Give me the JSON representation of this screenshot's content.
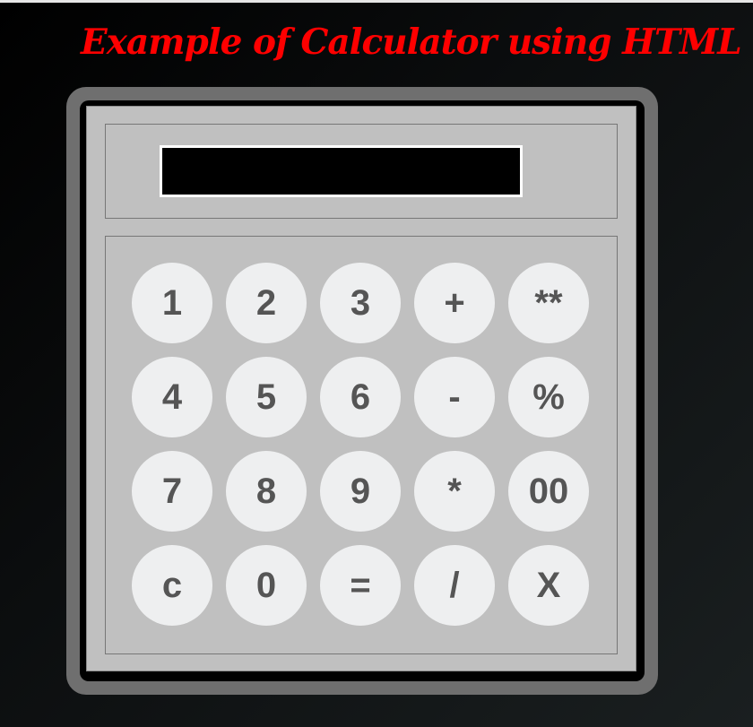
{
  "page": {
    "title": "Example of Calculator using HTML"
  },
  "display": {
    "value": ""
  },
  "keys": [
    {
      "label": "1",
      "name": "key-1"
    },
    {
      "label": "2",
      "name": "key-2"
    },
    {
      "label": "3",
      "name": "key-3"
    },
    {
      "label": "+",
      "name": "key-plus"
    },
    {
      "label": "**",
      "name": "key-power"
    },
    {
      "label": "4",
      "name": "key-4"
    },
    {
      "label": "5",
      "name": "key-5"
    },
    {
      "label": "6",
      "name": "key-6"
    },
    {
      "label": "-",
      "name": "key-minus"
    },
    {
      "label": "%",
      "name": "key-percent"
    },
    {
      "label": "7",
      "name": "key-7"
    },
    {
      "label": "8",
      "name": "key-8"
    },
    {
      "label": "9",
      "name": "key-9"
    },
    {
      "label": "*",
      "name": "key-multiply"
    },
    {
      "label": "00",
      "name": "key-double-zero"
    },
    {
      "label": "c",
      "name": "key-clear"
    },
    {
      "label": "0",
      "name": "key-0"
    },
    {
      "label": "=",
      "name": "key-equals"
    },
    {
      "label": "/",
      "name": "key-divide"
    },
    {
      "label": "X",
      "name": "key-backspace"
    }
  ],
  "colors": {
    "title": "#ff0000",
    "frame": "#6f6f6f",
    "body": "#c0c0c0",
    "display_bg": "#000000",
    "display_border": "#ffffff",
    "key_bg": "#eeeff0",
    "key_text": "#555555"
  }
}
